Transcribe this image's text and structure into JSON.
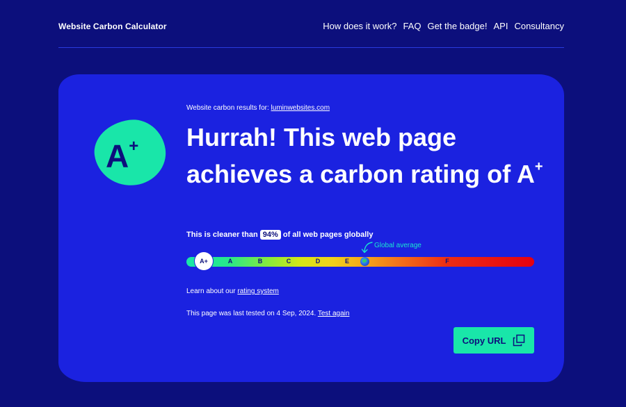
{
  "header": {
    "logo": "Website Carbon Calculator",
    "nav": [
      "How does it work?",
      "FAQ",
      "Get the badge!",
      "API",
      "Consultancy"
    ]
  },
  "result": {
    "rating": "A",
    "rating_plus": "+",
    "results_for_label": "Website carbon results for:",
    "url": "luminwebsites.com",
    "headline": "Hurrah! This web page achieves a carbon rating of",
    "cleaner_prefix": "This is cleaner than",
    "cleaner_percent": "94%",
    "cleaner_suffix": "of all web pages globally",
    "scale": {
      "current": "A+",
      "grades": [
        "A",
        "B",
        "C",
        "D",
        "E",
        "F"
      ],
      "global_average_label": "Global average"
    },
    "learn_prefix": "Learn about our",
    "learn_link": "rating system",
    "tested_text": "This page was last tested on 4 Sep, 2024.",
    "test_again": "Test again",
    "copy_url": "Copy URL"
  },
  "colors": {
    "background": "#0c0f7c",
    "card": "#1b22e0",
    "accent": "#19e6a9"
  },
  "icons": [
    "globe-icon",
    "arrow-icon",
    "copy-icon"
  ]
}
